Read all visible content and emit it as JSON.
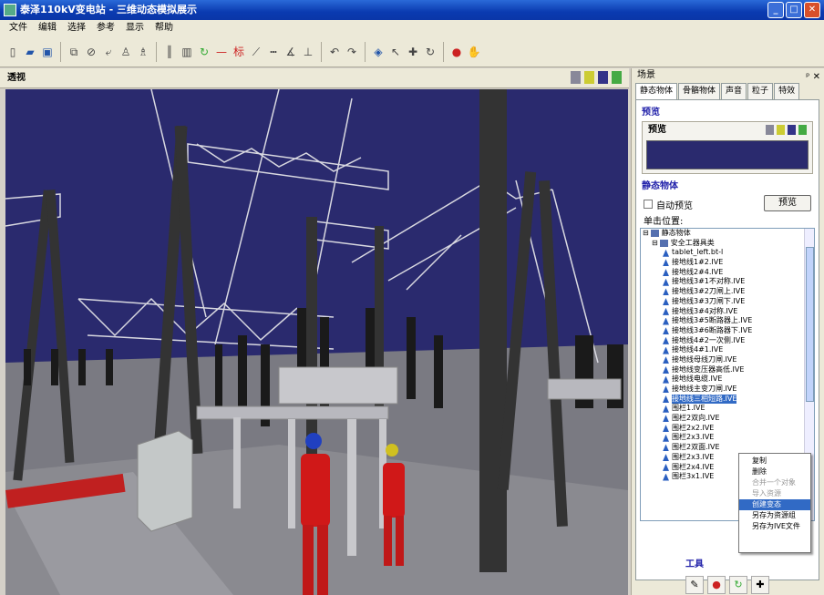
{
  "window": {
    "title": "泰泽110kV变电站 - 三维动态模拟展示"
  },
  "menu": [
    "文件",
    "编辑",
    "选择",
    "参考",
    "显示",
    "帮助"
  ],
  "view": {
    "title": "透视"
  },
  "panel": {
    "title": "场景",
    "tabs": [
      "静态物体",
      "骨骼物体",
      "声音",
      "粒子",
      "特效"
    ],
    "preview_section": "预览",
    "preview_label": "预览",
    "static_section": "静态物体",
    "auto_preview": "自动预览",
    "preview_button": "预览",
    "position_label": "单击位置:",
    "tree": {
      "root": "静态物体",
      "folder": "安全工器具类",
      "items": [
        "tablet_left.bt-l",
        "接地线1#2.IVE",
        "接地线2#4.IVE",
        "接地线3#1不对称.IVE",
        "接地线3#2刀闸上.IVE",
        "接地线3#3刀闸下.IVE",
        "接地线3#4对称.IVE",
        "接地线3#5断路器上.IVE",
        "接地线3#6断路器下.IVE",
        "接地线4#2一次侧.IVE",
        "接地线4#1.IVE",
        "接地线母线刀闸.IVE",
        "接地线变压器高低.IVE",
        "接地线电缆.IVE",
        "接地线主变刀闸.IVE",
        "接地线三相短路.IVE",
        "围栏1.IVE",
        "围栏2双向.IVE",
        "围栏2x2.IVE",
        "围栏2x3.IVE",
        "围栏2双面.IVE",
        "围栏2x3.IVE",
        "围栏2x4.IVE",
        "围栏3x1.IVE"
      ]
    },
    "tools_section": "工具"
  },
  "context_menu": [
    "复制",
    "删除",
    "合并一个对象",
    "导入资源",
    "创建变态",
    "另存为资源组",
    "另存为IVE文件"
  ],
  "colors": {
    "sky": "#2a2a6e",
    "ground": "#7a7a82",
    "selection": "#316ac5"
  }
}
